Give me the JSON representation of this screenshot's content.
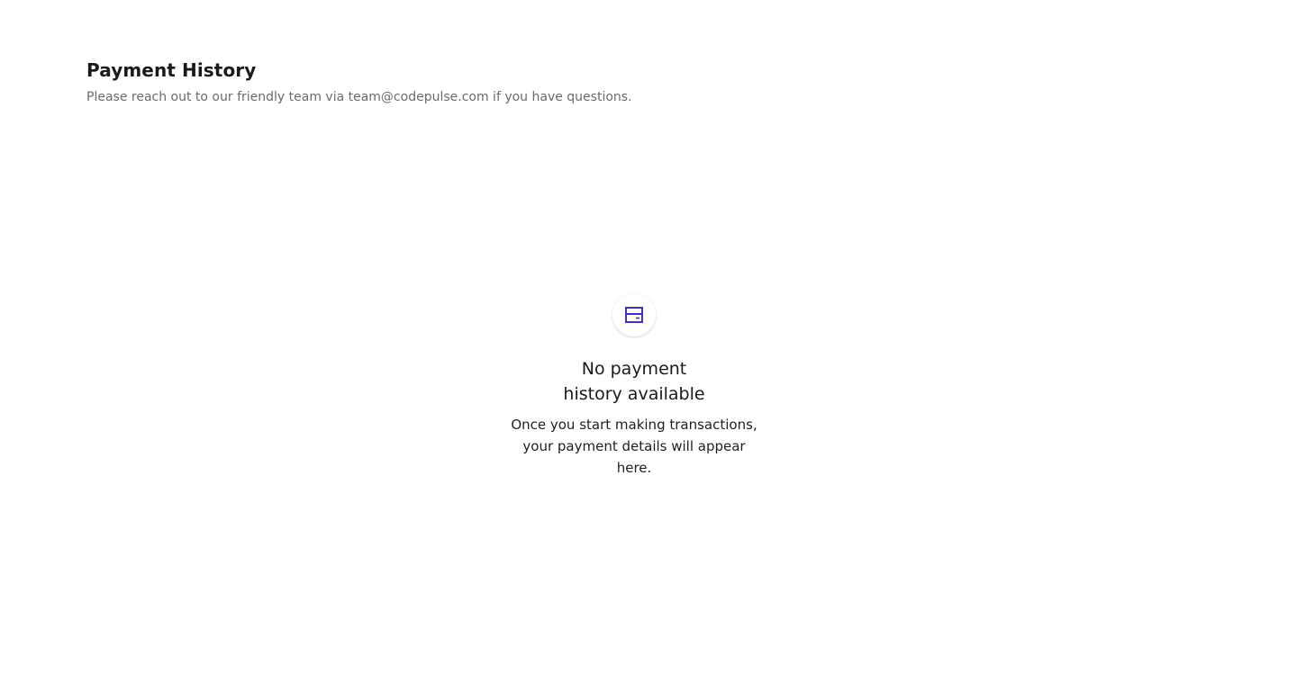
{
  "header": {
    "title": "Payment History",
    "subtitle": "Please reach out to our friendly team via team@codepulse.com if you have questions."
  },
  "empty_state": {
    "icon": "credit-card-icon",
    "title": "No payment history available",
    "description": "Once you start making transactions, your payment details will appear here."
  },
  "colors": {
    "accent": "#3d2fd1",
    "subtitle_text": "#6b6b6b"
  }
}
